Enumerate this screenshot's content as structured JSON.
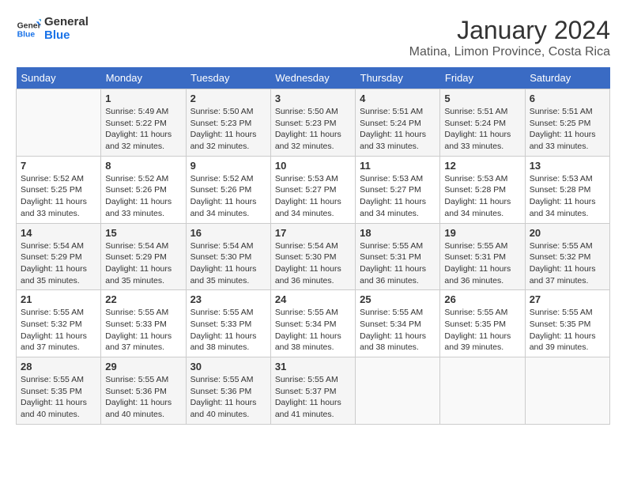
{
  "logo": {
    "line1": "General",
    "line2": "Blue"
  },
  "title": "January 2024",
  "subtitle": "Matina, Limon Province, Costa Rica",
  "days_of_week": [
    "Sunday",
    "Monday",
    "Tuesday",
    "Wednesday",
    "Thursday",
    "Friday",
    "Saturday"
  ],
  "weeks": [
    [
      {
        "day": "",
        "info": ""
      },
      {
        "day": "1",
        "info": "Sunrise: 5:49 AM\nSunset: 5:22 PM\nDaylight: 11 hours\nand 32 minutes."
      },
      {
        "day": "2",
        "info": "Sunrise: 5:50 AM\nSunset: 5:23 PM\nDaylight: 11 hours\nand 32 minutes."
      },
      {
        "day": "3",
        "info": "Sunrise: 5:50 AM\nSunset: 5:23 PM\nDaylight: 11 hours\nand 32 minutes."
      },
      {
        "day": "4",
        "info": "Sunrise: 5:51 AM\nSunset: 5:24 PM\nDaylight: 11 hours\nand 33 minutes."
      },
      {
        "day": "5",
        "info": "Sunrise: 5:51 AM\nSunset: 5:24 PM\nDaylight: 11 hours\nand 33 minutes."
      },
      {
        "day": "6",
        "info": "Sunrise: 5:51 AM\nSunset: 5:25 PM\nDaylight: 11 hours\nand 33 minutes."
      }
    ],
    [
      {
        "day": "7",
        "info": "Sunrise: 5:52 AM\nSunset: 5:25 PM\nDaylight: 11 hours\nand 33 minutes."
      },
      {
        "day": "8",
        "info": "Sunrise: 5:52 AM\nSunset: 5:26 PM\nDaylight: 11 hours\nand 33 minutes."
      },
      {
        "day": "9",
        "info": "Sunrise: 5:52 AM\nSunset: 5:26 PM\nDaylight: 11 hours\nand 34 minutes."
      },
      {
        "day": "10",
        "info": "Sunrise: 5:53 AM\nSunset: 5:27 PM\nDaylight: 11 hours\nand 34 minutes."
      },
      {
        "day": "11",
        "info": "Sunrise: 5:53 AM\nSunset: 5:27 PM\nDaylight: 11 hours\nand 34 minutes."
      },
      {
        "day": "12",
        "info": "Sunrise: 5:53 AM\nSunset: 5:28 PM\nDaylight: 11 hours\nand 34 minutes."
      },
      {
        "day": "13",
        "info": "Sunrise: 5:53 AM\nSunset: 5:28 PM\nDaylight: 11 hours\nand 34 minutes."
      }
    ],
    [
      {
        "day": "14",
        "info": "Sunrise: 5:54 AM\nSunset: 5:29 PM\nDaylight: 11 hours\nand 35 minutes."
      },
      {
        "day": "15",
        "info": "Sunrise: 5:54 AM\nSunset: 5:29 PM\nDaylight: 11 hours\nand 35 minutes."
      },
      {
        "day": "16",
        "info": "Sunrise: 5:54 AM\nSunset: 5:30 PM\nDaylight: 11 hours\nand 35 minutes."
      },
      {
        "day": "17",
        "info": "Sunrise: 5:54 AM\nSunset: 5:30 PM\nDaylight: 11 hours\nand 36 minutes."
      },
      {
        "day": "18",
        "info": "Sunrise: 5:55 AM\nSunset: 5:31 PM\nDaylight: 11 hours\nand 36 minutes."
      },
      {
        "day": "19",
        "info": "Sunrise: 5:55 AM\nSunset: 5:31 PM\nDaylight: 11 hours\nand 36 minutes."
      },
      {
        "day": "20",
        "info": "Sunrise: 5:55 AM\nSunset: 5:32 PM\nDaylight: 11 hours\nand 37 minutes."
      }
    ],
    [
      {
        "day": "21",
        "info": "Sunrise: 5:55 AM\nSunset: 5:32 PM\nDaylight: 11 hours\nand 37 minutes."
      },
      {
        "day": "22",
        "info": "Sunrise: 5:55 AM\nSunset: 5:33 PM\nDaylight: 11 hours\nand 37 minutes."
      },
      {
        "day": "23",
        "info": "Sunrise: 5:55 AM\nSunset: 5:33 PM\nDaylight: 11 hours\nand 38 minutes."
      },
      {
        "day": "24",
        "info": "Sunrise: 5:55 AM\nSunset: 5:34 PM\nDaylight: 11 hours\nand 38 minutes."
      },
      {
        "day": "25",
        "info": "Sunrise: 5:55 AM\nSunset: 5:34 PM\nDaylight: 11 hours\nand 38 minutes."
      },
      {
        "day": "26",
        "info": "Sunrise: 5:55 AM\nSunset: 5:35 PM\nDaylight: 11 hours\nand 39 minutes."
      },
      {
        "day": "27",
        "info": "Sunrise: 5:55 AM\nSunset: 5:35 PM\nDaylight: 11 hours\nand 39 minutes."
      }
    ],
    [
      {
        "day": "28",
        "info": "Sunrise: 5:55 AM\nSunset: 5:35 PM\nDaylight: 11 hours\nand 40 minutes."
      },
      {
        "day": "29",
        "info": "Sunrise: 5:55 AM\nSunset: 5:36 PM\nDaylight: 11 hours\nand 40 minutes."
      },
      {
        "day": "30",
        "info": "Sunrise: 5:55 AM\nSunset: 5:36 PM\nDaylight: 11 hours\nand 40 minutes."
      },
      {
        "day": "31",
        "info": "Sunrise: 5:55 AM\nSunset: 5:37 PM\nDaylight: 11 hours\nand 41 minutes."
      },
      {
        "day": "",
        "info": ""
      },
      {
        "day": "",
        "info": ""
      },
      {
        "day": "",
        "info": ""
      }
    ]
  ]
}
